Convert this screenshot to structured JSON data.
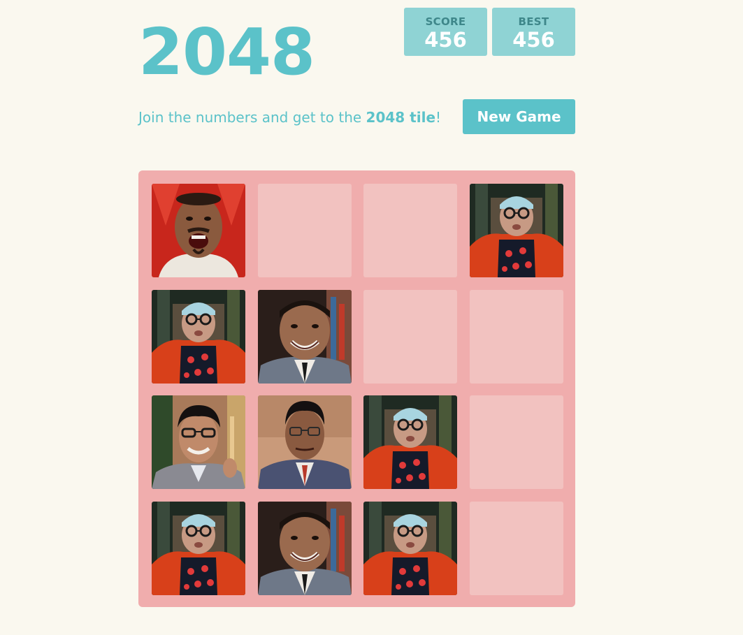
{
  "header": {
    "title": "2048",
    "score_label": "SCORE",
    "score_value": "456",
    "best_label": "BEST",
    "best_value": "456"
  },
  "intro": {
    "text_before": "Join the numbers and get to the ",
    "text_strong": "2048 tile",
    "text_after": "!"
  },
  "new_game_label": "New Game",
  "colors": {
    "accent": "#5bc2c9",
    "score_bg": "#8fd3d4",
    "board_bg": "#f0adad",
    "empty_cell": "#f2c2c0",
    "page_bg": "#faf8ef"
  },
  "board": {
    "rows": [
      [
        "shouting-man-portrait",
        "",
        "",
        "cap-glasses-man-portrait"
      ],
      [
        "cap-glasses-man-portrait",
        "smiling-man-portrait",
        "",
        ""
      ],
      [
        "glasses-young-man-portrait",
        "suit-glasses-man-portrait",
        "cap-glasses-man-portrait",
        ""
      ],
      [
        "cap-glasses-man-portrait",
        "smiling-man-portrait",
        "cap-glasses-man-portrait",
        ""
      ]
    ]
  }
}
